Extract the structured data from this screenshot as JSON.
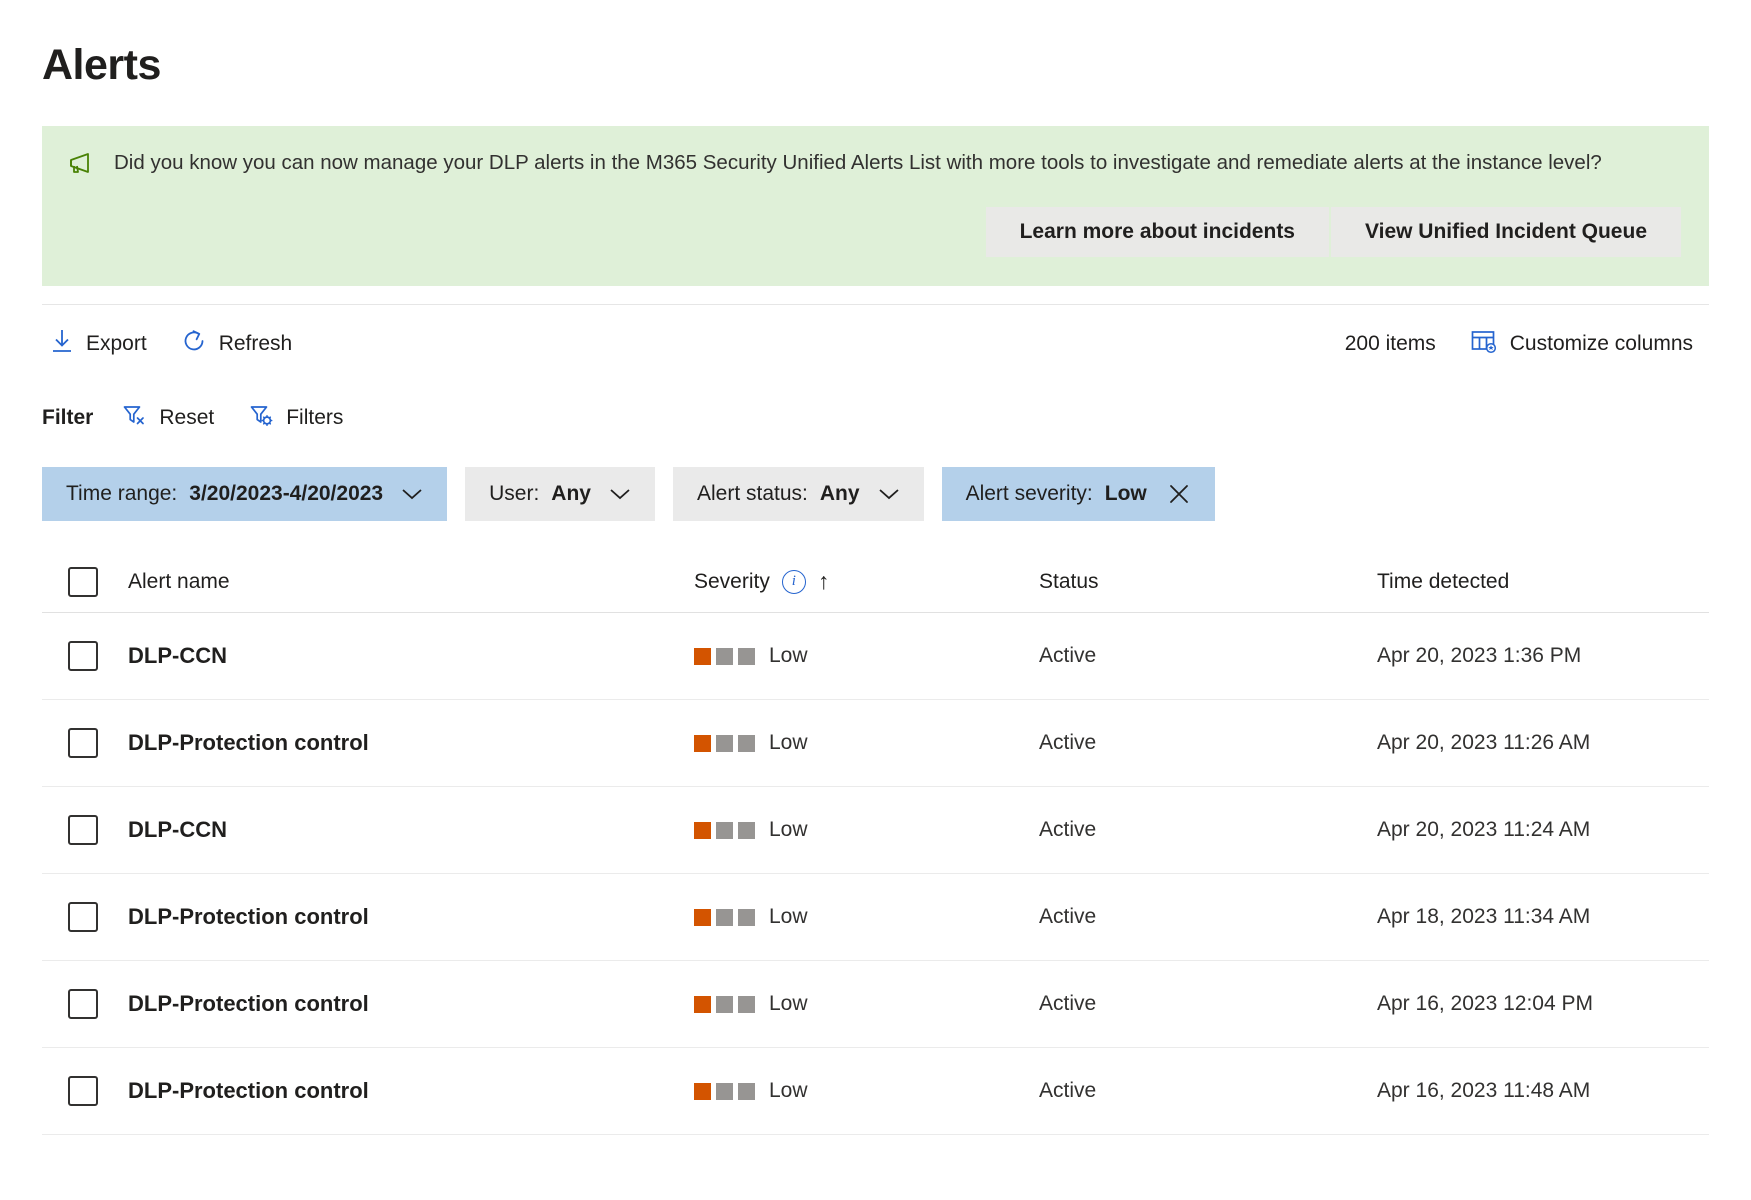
{
  "page": {
    "title": "Alerts"
  },
  "banner": {
    "icon": "megaphone-icon",
    "message": "Did you know you can now manage your DLP alerts in the M365 Security Unified Alerts List with more tools to investigate and remediate alerts at the instance level?",
    "learn_more_label": "Learn more about incidents",
    "view_queue_label": "View Unified Incident Queue",
    "background_color": "#dff0d8",
    "icon_color": "#498205"
  },
  "toolbar": {
    "export_label": "Export",
    "refresh_label": "Refresh",
    "items_count": "200 items",
    "customize_columns_label": "Customize columns",
    "accent_color": "#2564cf"
  },
  "filter": {
    "label": "Filter",
    "reset_label": "Reset",
    "filters_label": "Filters",
    "pills": [
      {
        "key": "Time range:",
        "value": "3/20/2023-4/20/2023",
        "state": "active",
        "affordance": "chevron-down-icon"
      },
      {
        "key": "User:",
        "value": "Any",
        "state": "neutral",
        "affordance": "chevron-down-icon"
      },
      {
        "key": "Alert status:",
        "value": "Any",
        "state": "neutral",
        "affordance": "chevron-down-icon"
      },
      {
        "key": "Alert severity:",
        "value": "Low",
        "state": "active",
        "affordance": "close-icon"
      }
    ],
    "active_pill_color": "#b4d0ea",
    "neutral_pill_color": "#eaeaea"
  },
  "table": {
    "columns": {
      "name": "Alert name",
      "severity": "Severity",
      "status": "Status",
      "time": "Time detected"
    },
    "sort_indicator": "↑",
    "rows": [
      {
        "name": "DLP-CCN",
        "severity": "Low",
        "severity_level": 1,
        "status": "Active",
        "time": "Apr 20, 2023 1:36 PM"
      },
      {
        "name": "DLP-Protection control",
        "severity": "Low",
        "severity_level": 1,
        "status": "Active",
        "time": "Apr 20, 2023 11:26 AM"
      },
      {
        "name": "DLP-CCN",
        "severity": "Low",
        "severity_level": 1,
        "status": "Active",
        "time": "Apr 20, 2023 11:24 AM"
      },
      {
        "name": "DLP-Protection control",
        "severity": "Low",
        "severity_level": 1,
        "status": "Active",
        "time": "Apr 18, 2023 11:34 AM"
      },
      {
        "name": "DLP-Protection control",
        "severity": "Low",
        "severity_level": 1,
        "status": "Active",
        "time": "Apr 16, 2023 12:04 PM"
      },
      {
        "name": "DLP-Protection control",
        "severity": "Low",
        "severity_level": 1,
        "status": "Active",
        "time": "Apr 16, 2023 11:48 AM"
      }
    ],
    "severity_on_color": "#d35400",
    "severity_off_color": "#979593"
  }
}
